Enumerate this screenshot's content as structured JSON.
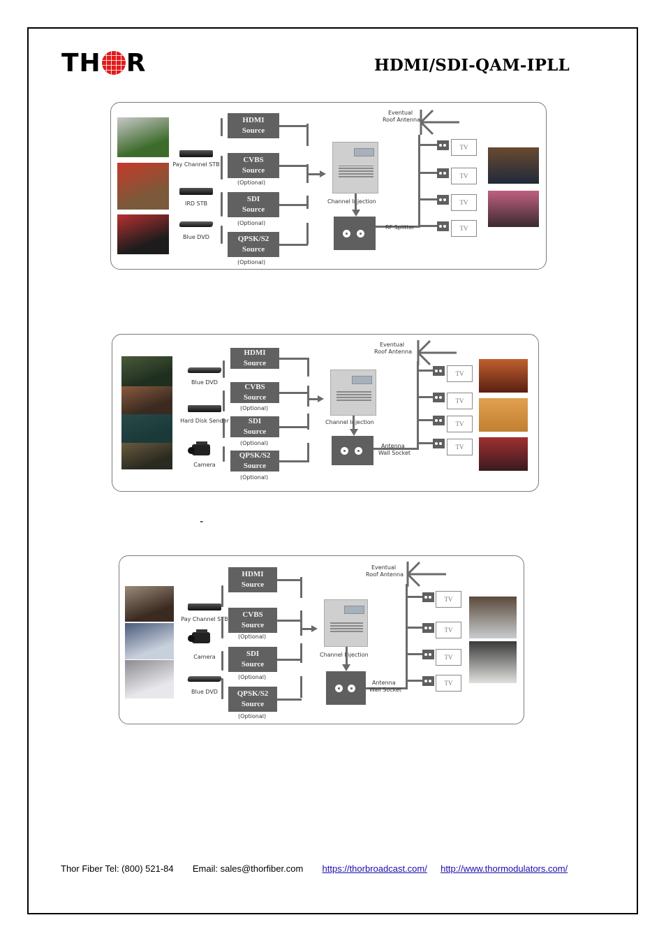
{
  "header": {
    "logo_text_left": "TH",
    "logo_text_right": "R",
    "title": "HDMI/SDI-QAM-IPLL"
  },
  "stray_text": "-",
  "diagrams": [
    {
      "photos": [
        "soccer-match",
        "basketball-game",
        "baseball-game"
      ],
      "right_photos": [
        "sports-bar",
        "restaurant-with-tvs"
      ],
      "devices": [
        "Pay Channel STB",
        "IRD STB",
        "Blue DVD"
      ],
      "sources": [
        {
          "line1": "HDMI",
          "line2": "Source",
          "optional": ""
        },
        {
          "line1": "CVBS",
          "line2": "Source",
          "optional": "(Optional)"
        },
        {
          "line1": "SDI",
          "line2": "Source",
          "optional": "(Optional)"
        },
        {
          "line1": "QPSK/S2",
          "line2": "Source",
          "optional": "(Optional)"
        }
      ],
      "antenna_label_1": "Eventual",
      "antenna_label_2": "Roof Antenna",
      "injection_label": "Channel Injection",
      "distribution_label_1": "RF Splitter",
      "distribution_label_2": "",
      "tv_labels": [
        "TV",
        "TV",
        "TV",
        "TV"
      ]
    },
    {
      "photos": [
        "movie-scene-1",
        "movie-scene-2",
        "movie-scene-3",
        "movie-scene-4"
      ],
      "right_photos": [
        "hotel-lounge",
        "cinema-lobby",
        "cinema-hall"
      ],
      "devices": [
        "Blue DVD",
        "Hard Disk Sender",
        "Camera"
      ],
      "sources": [
        {
          "line1": "HDMI",
          "line2": "Source",
          "optional": ""
        },
        {
          "line1": "CVBS",
          "line2": "Source",
          "optional": "(Optional)"
        },
        {
          "line1": "SDI",
          "line2": "Source",
          "optional": "(Optional)"
        },
        {
          "line1": "QPSK/S2",
          "line2": "Source",
          "optional": "(Optional)"
        }
      ],
      "antenna_label_1": "Eventual",
      "antenna_label_2": "Roof Antenna",
      "injection_label": "Channel Injection",
      "distribution_label_1": "Antenna",
      "distribution_label_2": "Wall Socket",
      "tv_labels": [
        "TV",
        "TV",
        "TV",
        "TV"
      ]
    },
    {
      "photos": [
        "business-meeting",
        "video-conference",
        "presentation"
      ],
      "right_photos": [
        "conference-room",
        "classroom"
      ],
      "devices": [
        "Pay Channel STB",
        "Camera",
        "Blue DVD"
      ],
      "sources": [
        {
          "line1": "HDMI",
          "line2": "Source",
          "optional": ""
        },
        {
          "line1": "CVBS",
          "line2": "Source",
          "optional": "(Optional)"
        },
        {
          "line1": "SDI",
          "line2": "Source",
          "optional": "(Optional)"
        },
        {
          "line1": "QPSK/S2",
          "line2": "Source",
          "optional": "(Optional)"
        }
      ],
      "antenna_label_1": "Eventual",
      "antenna_label_2": "Roof Antenna",
      "injection_label": "Channel Injection",
      "distribution_label_1": "Antenna",
      "distribution_label_2": "Wall Socket",
      "tv_labels": [
        "TV",
        "TV",
        "TV",
        "TV"
      ]
    }
  ],
  "footer": {
    "tel": "Thor Fiber Tel: (800) 521-84",
    "email": "Email: sales@thorfiber.com",
    "link1": "https://thorbroadcast.com/",
    "link2": "http://www.thormodulators.com/"
  },
  "colors": {
    "logo_globe": "#e11b1b",
    "diagram_box": "#616161",
    "link": "#1a0dab"
  }
}
